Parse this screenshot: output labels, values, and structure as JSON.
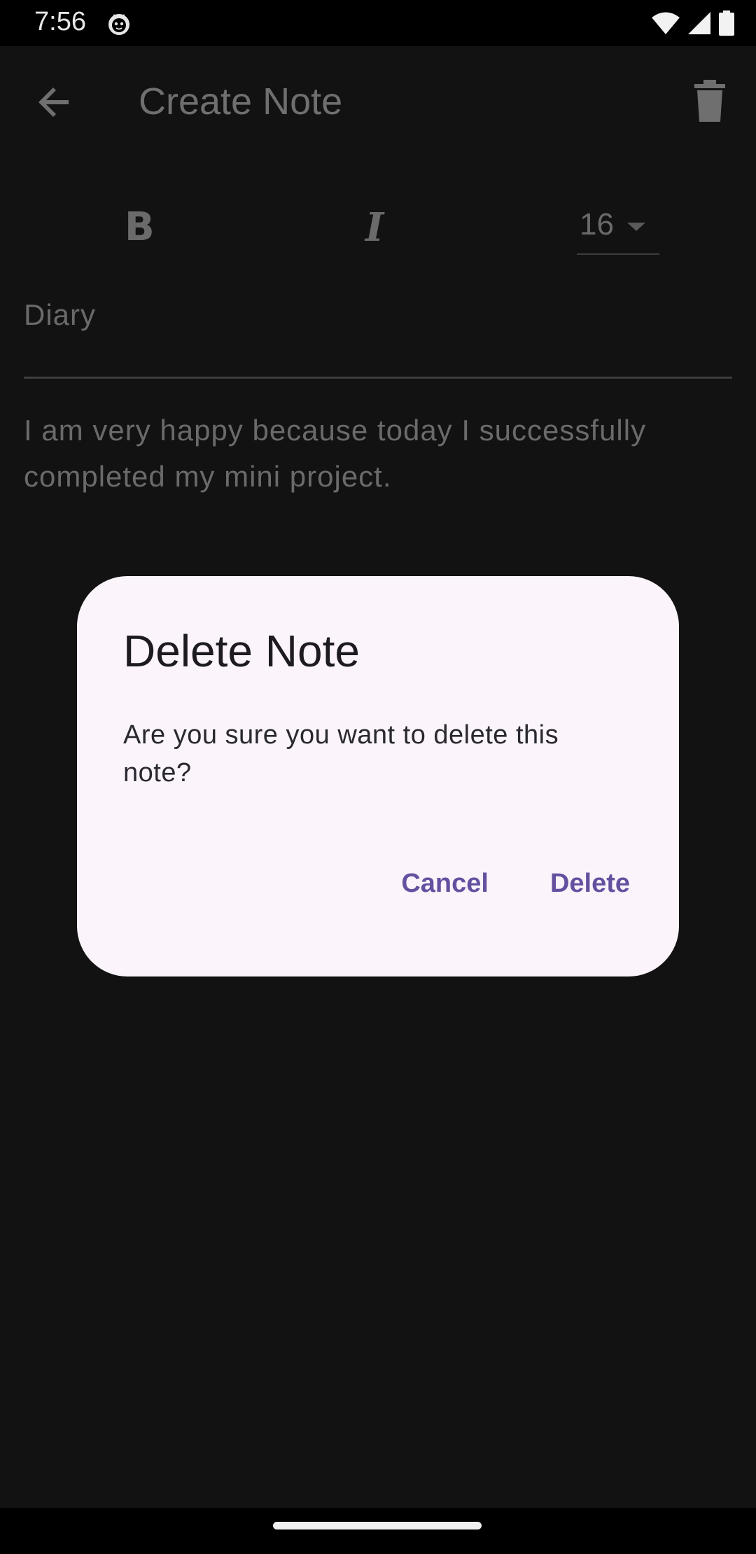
{
  "status_bar": {
    "time": "7:56",
    "icons": [
      "cat-icon",
      "wifi-icon",
      "signal-icon",
      "battery-icon"
    ]
  },
  "app_bar": {
    "title": "Create Note",
    "back_icon": "arrow-back-icon",
    "delete_icon": "trash-icon"
  },
  "toolbar": {
    "bold_label": "B",
    "italic_label": "I",
    "font_size": "16"
  },
  "note": {
    "title": "Diary",
    "body": "I am very happy because today I successfully completed my mini project."
  },
  "dialog": {
    "title": "Delete Note",
    "message": "Are you sure you want to delete this note?",
    "cancel_label": "Cancel",
    "confirm_label": "Delete"
  },
  "colors": {
    "background": "#121212",
    "dialog_surface": "#fbf5fb",
    "accent": "#6550a0"
  }
}
